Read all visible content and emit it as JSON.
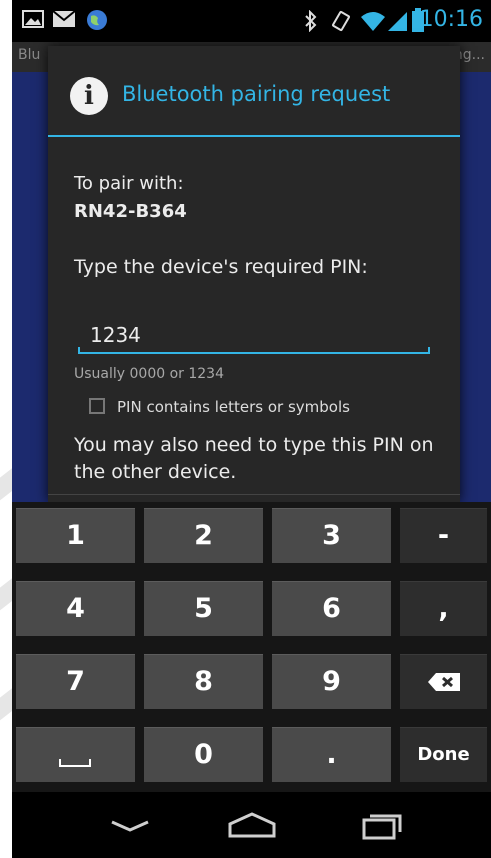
{
  "status_bar": {
    "time": "10:16",
    "icons_left": [
      "picture-icon",
      "mail-icon",
      "globe-icon"
    ],
    "icons_right": [
      "bluetooth-icon",
      "vibrate-icon",
      "wifi-icon",
      "signal-icon",
      "battery-icon"
    ],
    "accent": "#34b5e5"
  },
  "background_app": {
    "title": "Blu",
    "right_text": "ng..."
  },
  "dialog": {
    "icon": "info-icon",
    "title": "Bluetooth pairing request",
    "accent_color": "#33b5e5",
    "pair_with": "To pair with:",
    "device_name": "RN42-B364",
    "pin_prompt": "Type the device's required PIN:",
    "pin_value": "1234",
    "hint": "Usually 0000 or 1234",
    "checkbox_label": "PIN contains letters or symbols",
    "checkbox_checked": false,
    "also_need": "You may also need to type this PIN on the other device."
  },
  "keyboard": {
    "rows": [
      [
        "1",
        "2",
        "3",
        "-"
      ],
      [
        "4",
        "5",
        "6",
        ","
      ],
      [
        "7",
        "8",
        "9",
        "backspace-icon"
      ],
      [
        "space-icon",
        "0",
        ".",
        "Done"
      ]
    ],
    "done_label": "Done"
  },
  "nav_bar": {
    "buttons": [
      "back-icon",
      "home-icon",
      "recent-apps-icon"
    ]
  }
}
